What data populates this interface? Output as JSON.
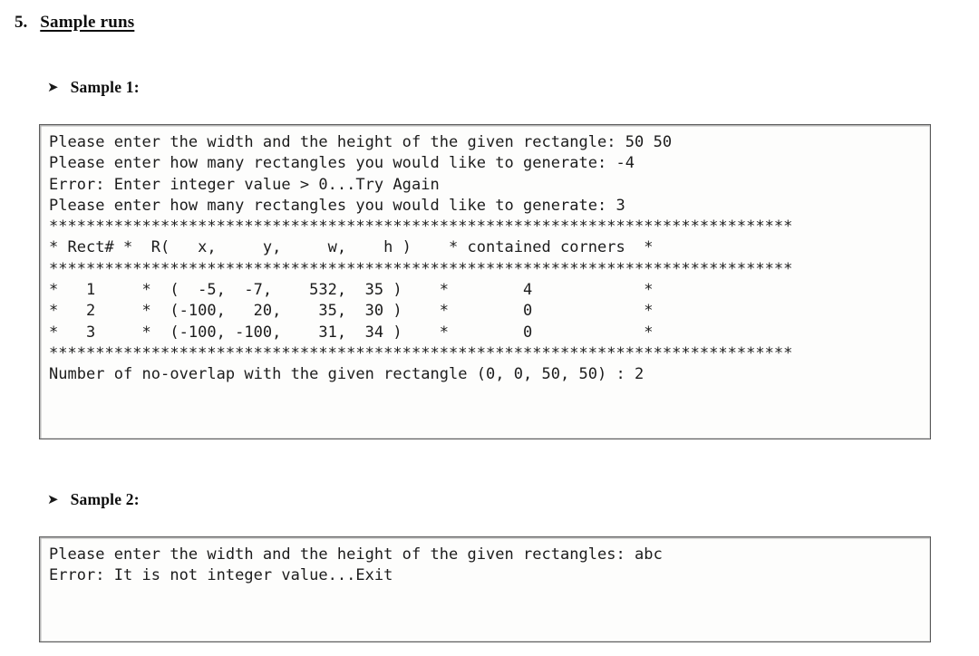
{
  "section": {
    "number": "5.",
    "title": "Sample runs"
  },
  "samples": [
    {
      "bullet": "➤",
      "label": "Sample 1:",
      "console_lines": [
        "Please enter the width and the height of the given rectangle: 50 50",
        "Please enter how many rectangles you would like to generate: -4",
        "Error: Enter integer value > 0...Try Again",
        "Please enter how many rectangles you would like to generate: 3",
        "********************************************************************************",
        "* Rect# *  R(   x,     y,     w,    h )    * contained corners  *",
        "********************************************************************************",
        "*   1     *  (  -5,  -7,    532,  35 )    *        4            *",
        "*   2     *  (-100,   20,    35,  30 )    *        0            *",
        "*   3     *  (-100, -100,    31,  34 )    *        0            *",
        "********************************************************************************",
        "Number of no-overlap with the given rectangle (0, 0, 50, 50) : 2"
      ]
    },
    {
      "bullet": "➤",
      "label": "Sample 2:",
      "console_lines": [
        "Please enter the width and the height of the given rectangles: abc",
        "Error: It is not integer value...Exit"
      ]
    }
  ],
  "colors": {
    "text": "#111111",
    "console_text": "#1c1c1c",
    "console_background": "#fdfdfc",
    "console_border": "#5c5c5c",
    "page_background": "#ffffff"
  }
}
